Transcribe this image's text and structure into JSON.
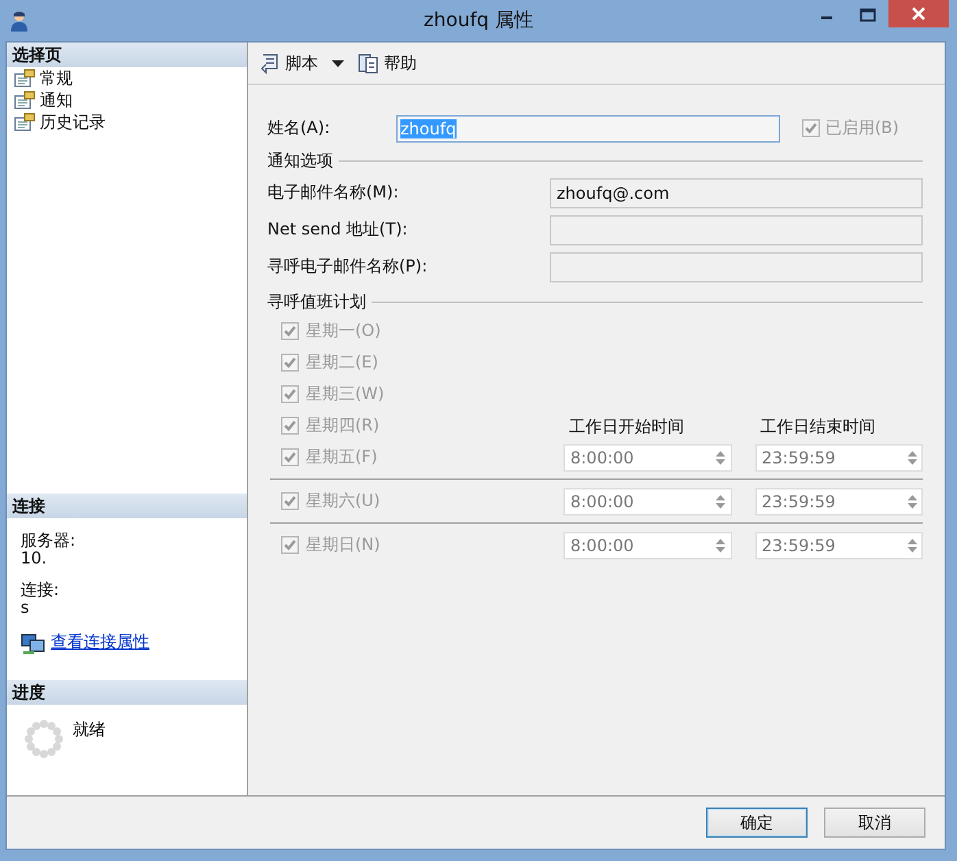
{
  "window": {
    "title": "zhoufq 属性"
  },
  "sidebar": {
    "pages": {
      "heading": "选择页",
      "items": [
        {
          "label": "常规"
        },
        {
          "label": "通知"
        },
        {
          "label": "历史记录"
        }
      ]
    },
    "connection": {
      "heading": "连接",
      "server_label": "服务器:",
      "server_value": "10.",
      "connection_label": "连接:",
      "connection_value": "s",
      "link": "查看连接属性"
    },
    "progress": {
      "heading": "进度",
      "status": "就绪"
    }
  },
  "toolbar": [
    {
      "label": "脚本",
      "kind": "dropdown"
    },
    {
      "label": "帮助",
      "kind": "help"
    }
  ],
  "form": {
    "name_label": "姓名(A):",
    "name_value": "zhoufq",
    "enabled": {
      "label": "已启用(B)",
      "checked": true,
      "disabled": true
    },
    "notify": {
      "heading": "通知选项",
      "fields": [
        {
          "label": "电子邮件名称(M):",
          "value": "zhoufq@.com"
        },
        {
          "label": "Net send 地址(T):"
        },
        {
          "label": "寻呼电子邮件名称(P):"
        }
      ]
    },
    "schedule": {
      "heading": "寻呼值班计划",
      "start_header": "工作日开始时间",
      "end_header": "工作日结束时间",
      "groups": [
        {
          "days": [
            {
              "label": "星期一(O)",
              "checked": true,
              "disabled": true
            },
            {
              "label": "星期二(E)",
              "checked": true,
              "disabled": true
            },
            {
              "label": "星期三(W)",
              "checked": true,
              "disabled": true
            },
            {
              "label": "星期四(R)",
              "checked": true,
              "disabled": true
            },
            {
              "label": "星期五(F)",
              "checked": true,
              "disabled": true
            }
          ],
          "start": "8:00:00",
          "end": "23:59:59"
        },
        {
          "days": [
            {
              "label": "星期六(U)",
              "checked": true,
              "disabled": true
            }
          ],
          "start": "8:00:00",
          "end": "23:59:59"
        },
        {
          "days": [
            {
              "label": "星期日(N)",
              "checked": true,
              "disabled": true
            }
          ],
          "start": "8:00:00",
          "end": "23:59:59"
        }
      ]
    }
  },
  "buttons": [
    {
      "label": "确定",
      "default": true
    },
    {
      "label": "取消",
      "default": false
    }
  ]
}
